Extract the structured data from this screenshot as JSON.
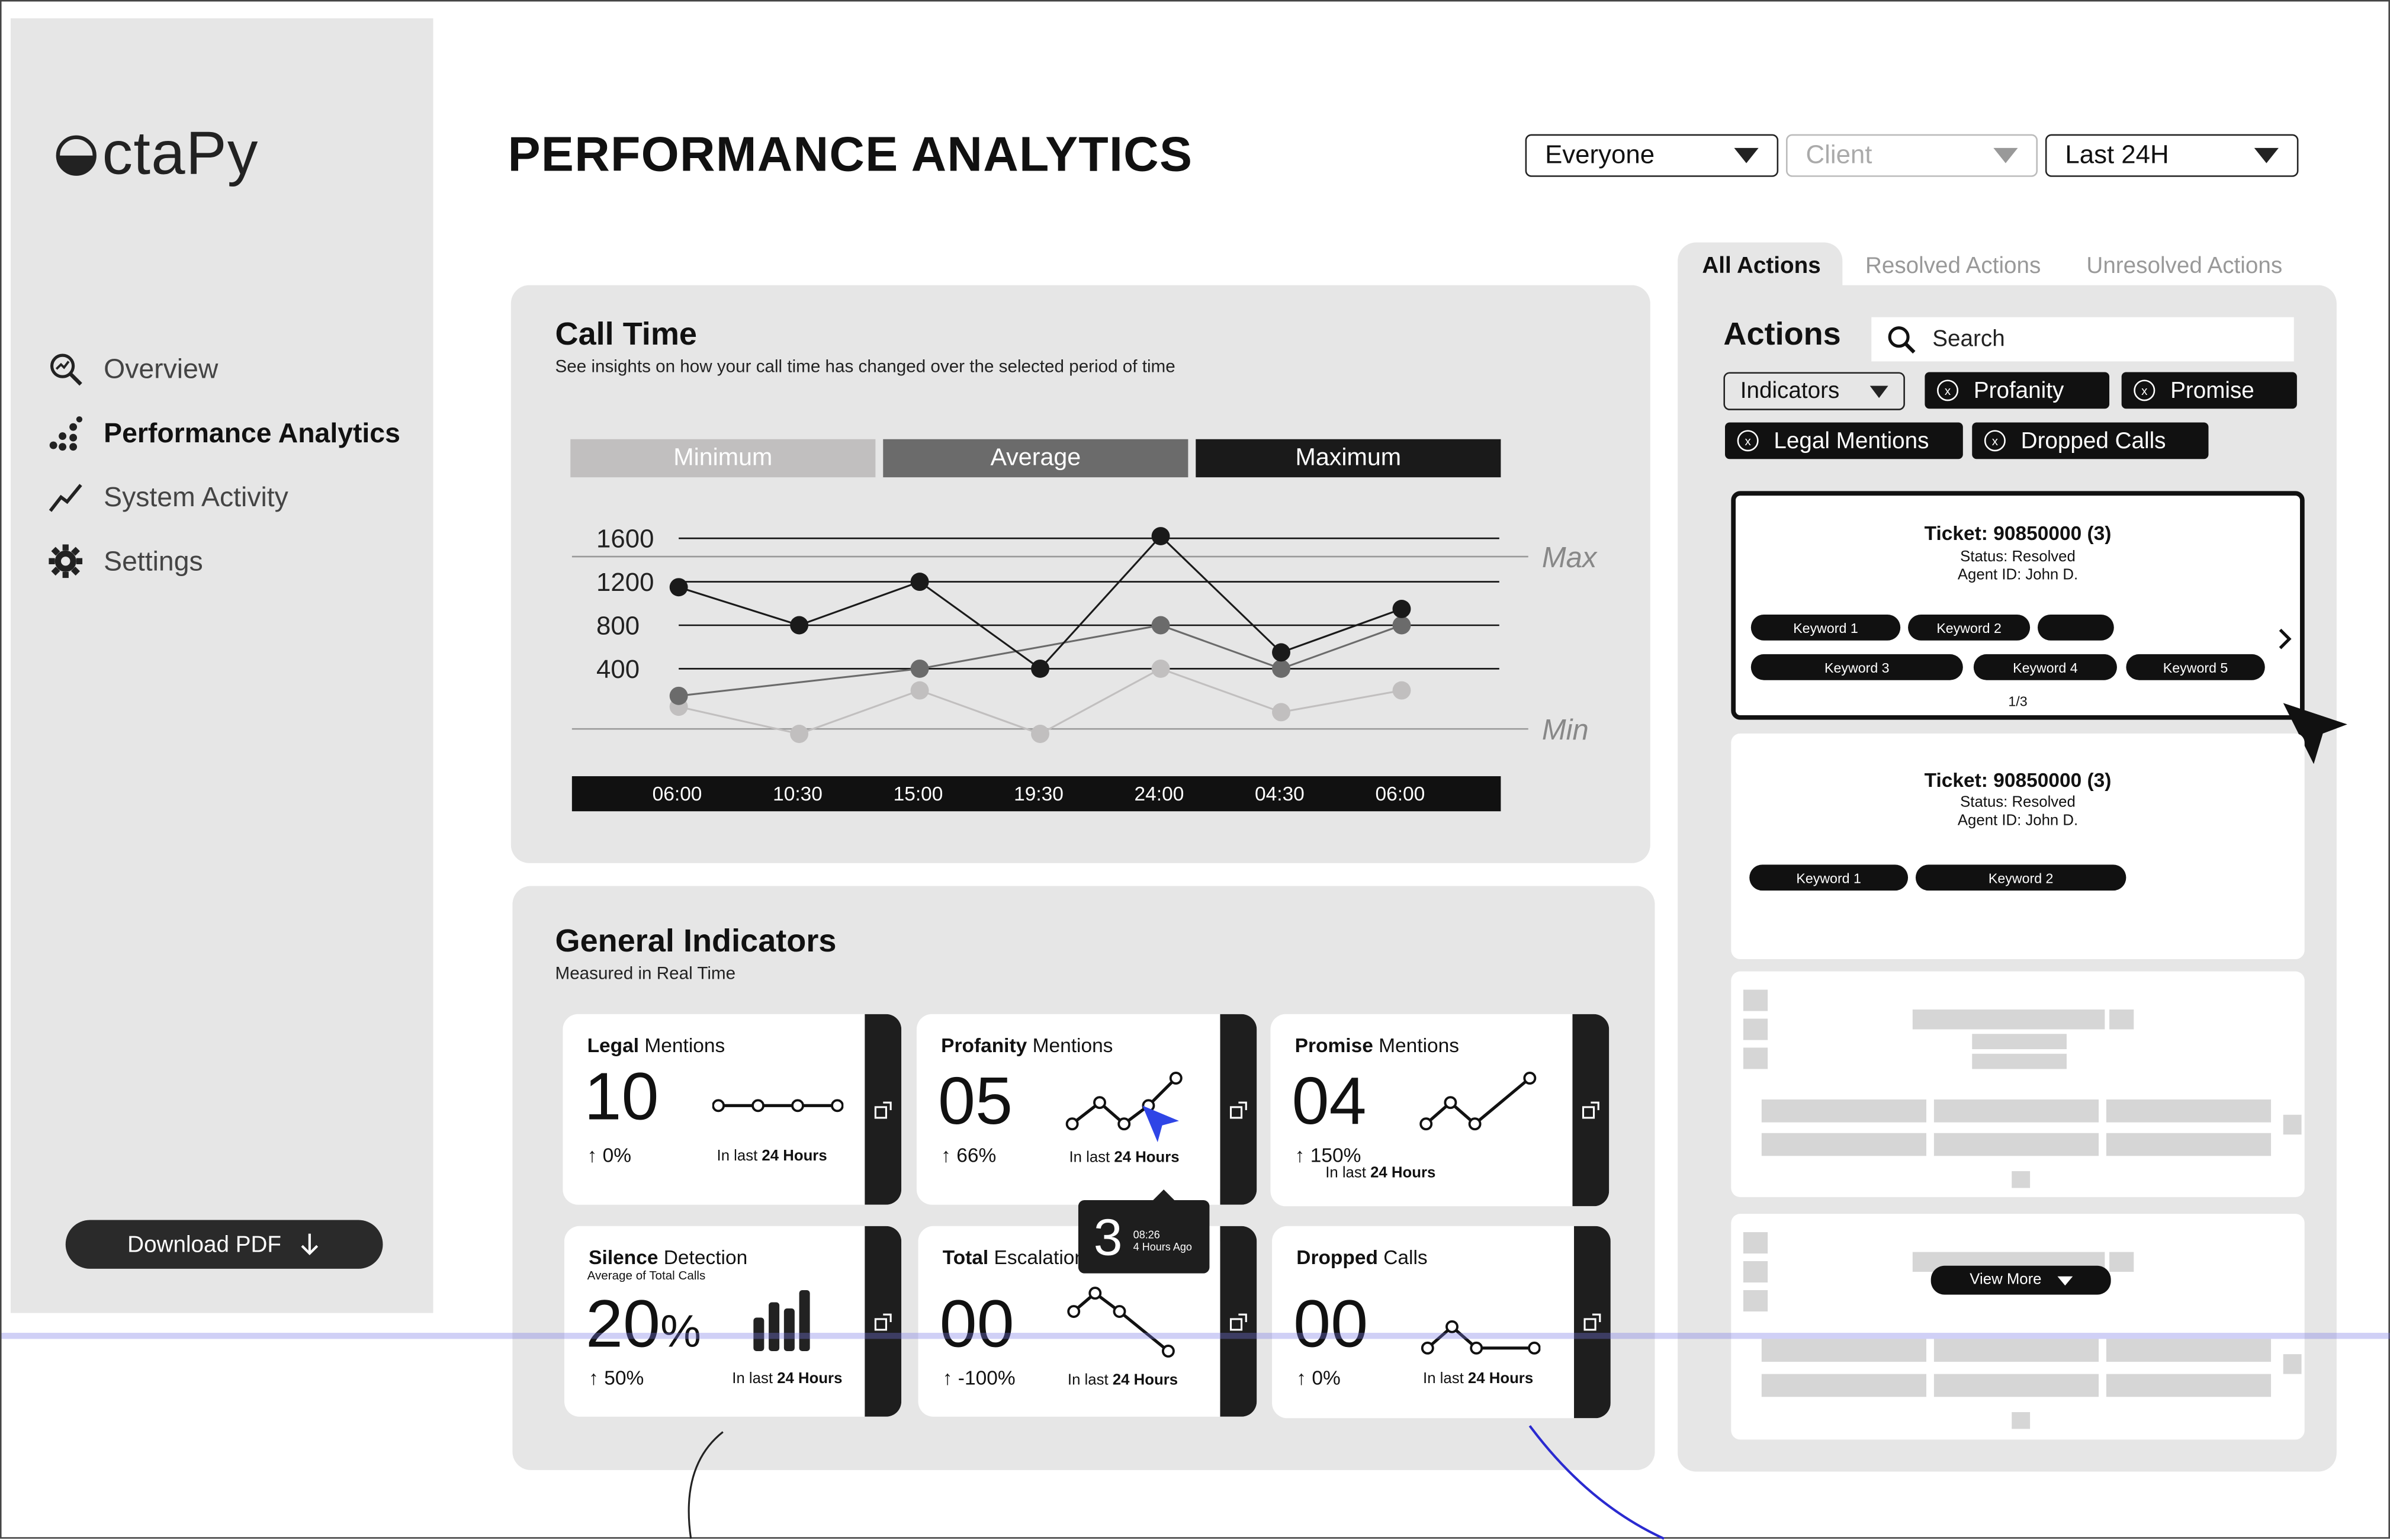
{
  "brand": {
    "name_rest": "ctaPy",
    "logo_icon": "half-filled-circle"
  },
  "nav": {
    "items": [
      {
        "label": "Overview",
        "icon": "magnifier-chart-icon"
      },
      {
        "label": "Performance Analytics",
        "icon": "scatter-chart-icon",
        "active": true
      },
      {
        "label": "System Activity",
        "icon": "trend-line-icon"
      },
      {
        "label": "Settings",
        "icon": "gear-icon"
      }
    ],
    "download_label": "Download PDF"
  },
  "header": {
    "title": "PERFORMANCE ANALYTICS",
    "filters": [
      {
        "value": "Everyone"
      },
      {
        "value": "Client",
        "placeholder": true
      },
      {
        "value": "Last 24H"
      }
    ]
  },
  "call_time": {
    "title": "Call Time",
    "subtitle": "See insights on how your call time has changed over the selected period of time"
  },
  "chart_data": {
    "type": "line",
    "legend": [
      "Minimum",
      "Average",
      "Maximum"
    ],
    "legend_colors": [
      "#c1bfbf",
      "#6b6b6b",
      "#1a1a1a"
    ],
    "x": [
      "06:00",
      "10:30",
      "15:00",
      "19:30",
      "24:00",
      "04:30",
      "06:00"
    ],
    "y_ticks": [
      1600,
      1200,
      800,
      400
    ],
    "ylim": [
      0,
      1800
    ],
    "reference_lines": [
      {
        "label": "Max",
        "value": 1400
      },
      {
        "label": "Min",
        "value": 0
      }
    ],
    "series": [
      {
        "name": "Maximum",
        "color": "#1a1a1a",
        "values": [
          1150,
          800,
          1200,
          400,
          1620,
          550,
          950
        ]
      },
      {
        "name": "Average",
        "color": "#6b6b6b",
        "values": [
          150,
          null,
          400,
          null,
          800,
          400,
          800
        ]
      },
      {
        "name": "Minimum",
        "color": "#c1bfbf",
        "values": [
          50,
          -200,
          200,
          -200,
          400,
          0,
          200
        ]
      }
    ],
    "grid": true
  },
  "indicators": {
    "title": "General Indicators",
    "subtitle": "Measured in Real Time",
    "cards": [
      {
        "title_bold": "Legal",
        "title_rest": " Mentions",
        "value": "10",
        "change": "0%",
        "foot_pre": "In last ",
        "foot_bold": "24 Hours"
      },
      {
        "title_bold": "Profanity",
        "title_rest": " Mentions",
        "value": "05",
        "change": "66%",
        "foot_pre": "In last ",
        "foot_bold": "24 Hours"
      },
      {
        "title_bold": "Promise",
        "title_rest": " Mentions",
        "value": "04",
        "change": "150%",
        "foot_pre": "In last ",
        "foot_bold": "24 Hours"
      },
      {
        "title_bold": "Silence",
        "title_rest": " Detection",
        "subtitle": "Average of Total Calls",
        "value": "20",
        "unit": "%",
        "change": "50%",
        "foot_pre": "In last ",
        "foot_bold": "24 Hours"
      },
      {
        "title_bold": "Total",
        "title_rest": " Escalation",
        "value": "00",
        "change": "-100%",
        "foot_pre": "In last ",
        "foot_bold": "24 Hours"
      },
      {
        "title_bold": "Dropped",
        "title_rest": " Calls",
        "value": "00",
        "change": "0%",
        "foot_pre": "In last ",
        "foot_bold": "24 Hours"
      }
    ],
    "tooltip": {
      "value": "3",
      "time": "08:26",
      "ago": "4 Hours Ago"
    }
  },
  "actions": {
    "tabs": [
      "All Actions",
      "Resolved Actions",
      "Unresolved Actions"
    ],
    "title": "Actions",
    "search_placeholder": "Search",
    "indicator_select": "Indicators",
    "chips": [
      "Profanity",
      "Promise",
      "Legal Mentions",
      "Dropped Calls"
    ],
    "tickets": [
      {
        "title": "Ticket: 90850000 (3)",
        "status": "Status: Resolved",
        "agent": "Agent ID: John D.",
        "keywords": [
          "Keyword 1",
          "Keyword 2",
          "",
          "Keyword 3",
          "Keyword 4",
          "Keyword 5"
        ],
        "pager": "1/3"
      },
      {
        "title": "Ticket: 90850000 (3)",
        "status": "Status: Resolved",
        "agent": "Agent ID: John D.",
        "keywords": [
          "Keyword 1",
          "Keyword 2"
        ]
      }
    ],
    "view_more": "View More"
  }
}
